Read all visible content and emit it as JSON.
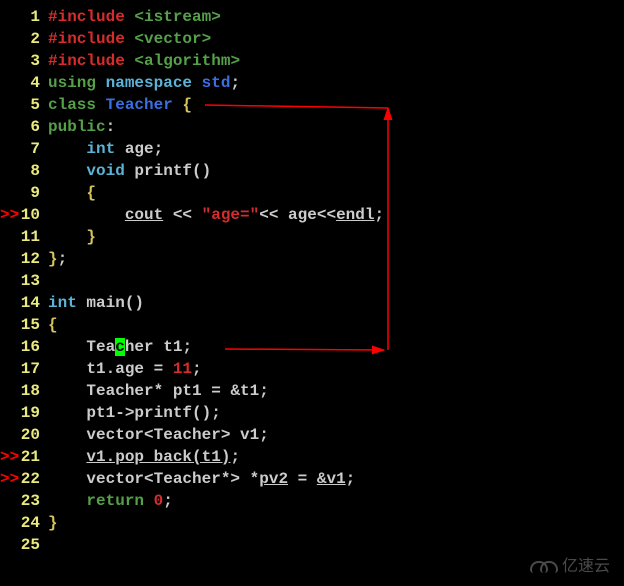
{
  "breakpoints": {
    "10": ">>",
    "21": ">>",
    "22": ">>"
  },
  "watermark": "亿速云",
  "lines": [
    {
      "n": 1,
      "tokens": [
        [
          "kw-pp",
          "#include "
        ],
        [
          "kw-inc",
          "<istream>"
        ]
      ]
    },
    {
      "n": 2,
      "tokens": [
        [
          "kw-pp",
          "#include "
        ],
        [
          "kw-inc",
          "<vector>"
        ]
      ]
    },
    {
      "n": 3,
      "tokens": [
        [
          "kw-pp",
          "#include "
        ],
        [
          "kw-inc",
          "<algorithm>"
        ]
      ]
    },
    {
      "n": 4,
      "tokens": [
        [
          "kw",
          "using "
        ],
        [
          "type",
          "namespace "
        ],
        [
          "cls",
          "std"
        ],
        [
          "punct",
          ";"
        ]
      ]
    },
    {
      "n": 5,
      "tokens": [
        [
          "kw",
          "class "
        ],
        [
          "cls",
          "Teacher "
        ],
        [
          "type2",
          "{"
        ]
      ]
    },
    {
      "n": 6,
      "tokens": [
        [
          "kw",
          "public"
        ],
        [
          "punct",
          ":"
        ]
      ]
    },
    {
      "n": 7,
      "tokens": [
        [
          "punct",
          "    "
        ],
        [
          "type",
          "int "
        ],
        [
          "ident",
          "age"
        ],
        [
          "punct",
          ";"
        ]
      ]
    },
    {
      "n": 8,
      "tokens": [
        [
          "punct",
          "    "
        ],
        [
          "type",
          "void "
        ],
        [
          "func",
          "printf"
        ],
        [
          "punct",
          "()"
        ]
      ]
    },
    {
      "n": 9,
      "tokens": [
        [
          "punct",
          "    "
        ],
        [
          "type2",
          "{"
        ]
      ]
    },
    {
      "n": 10,
      "tokens": [
        [
          "punct",
          "        "
        ],
        [
          "ident ul",
          "cout"
        ],
        [
          "punct",
          " << "
        ],
        [
          "str",
          "\"age=\""
        ],
        [
          "punct",
          "<< "
        ],
        [
          "ident",
          "age"
        ],
        [
          "punct",
          "<<"
        ],
        [
          "ident ul",
          "endl"
        ],
        [
          "punct",
          ";"
        ]
      ]
    },
    {
      "n": 11,
      "tokens": [
        [
          "punct",
          "    "
        ],
        [
          "type2",
          "}"
        ]
      ]
    },
    {
      "n": 12,
      "tokens": [
        [
          "type2",
          "}"
        ],
        [
          "punct",
          ";"
        ]
      ]
    },
    {
      "n": 13,
      "tokens": []
    },
    {
      "n": 14,
      "tokens": [
        [
          "type",
          "int "
        ],
        [
          "func",
          "main"
        ],
        [
          "punct",
          "()"
        ]
      ]
    },
    {
      "n": 15,
      "tokens": [
        [
          "type2",
          "{"
        ]
      ]
    },
    {
      "n": 16,
      "tokens": [
        [
          "punct",
          "    "
        ],
        [
          "ident",
          "Tea"
        ],
        [
          "cursor",
          "c"
        ],
        [
          "ident",
          "her "
        ],
        [
          "ident",
          "t1"
        ],
        [
          "punct",
          ";"
        ]
      ]
    },
    {
      "n": 17,
      "tokens": [
        [
          "punct",
          "    "
        ],
        [
          "ident",
          "t1.age"
        ],
        [
          "punct",
          " = "
        ],
        [
          "num",
          "11"
        ],
        [
          "punct",
          ";"
        ]
      ]
    },
    {
      "n": 18,
      "tokens": [
        [
          "punct",
          "    "
        ],
        [
          "ident",
          "Teacher* pt1"
        ],
        [
          "punct",
          " = "
        ],
        [
          "ident",
          "&t1"
        ],
        [
          "punct",
          ";"
        ]
      ]
    },
    {
      "n": 19,
      "tokens": [
        [
          "punct",
          "    "
        ],
        [
          "ident",
          "pt1->printf"
        ],
        [
          "punct",
          "();"
        ]
      ]
    },
    {
      "n": 20,
      "tokens": [
        [
          "punct",
          "    "
        ],
        [
          "ident",
          "vector<Teacher> v1"
        ],
        [
          "punct",
          ";"
        ]
      ]
    },
    {
      "n": 21,
      "tokens": [
        [
          "punct",
          "    "
        ],
        [
          "ident ul",
          "v1.pop back("
        ],
        [
          "ident ul",
          "t1"
        ],
        [
          "ident ul",
          ")"
        ],
        [
          "punct",
          ";"
        ]
      ]
    },
    {
      "n": 22,
      "tokens": [
        [
          "punct",
          "    "
        ],
        [
          "ident",
          "vector<Teacher*> *"
        ],
        [
          "ident ul",
          "pv2"
        ],
        [
          "punct",
          " = "
        ],
        [
          "ident ul",
          "&v1"
        ],
        [
          "punct",
          ";"
        ]
      ]
    },
    {
      "n": 23,
      "tokens": [
        [
          "punct",
          "    "
        ],
        [
          "kw",
          "return "
        ],
        [
          "num",
          "0"
        ],
        [
          "punct",
          ";"
        ]
      ]
    },
    {
      "n": 24,
      "tokens": [
        [
          "type2",
          "}"
        ]
      ]
    },
    {
      "n": 25,
      "tokens": []
    }
  ]
}
